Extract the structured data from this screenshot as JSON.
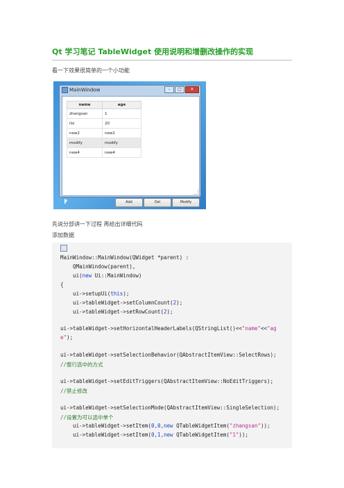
{
  "page": {
    "title": "Qt 学习笔记 TableWidget 使用说明和增删改操作的实现",
    "intro": "看一下效果很简单的一个小功能",
    "p2": "先说分部讲一下过程 再给出详细代码",
    "p3": "添加数据"
  },
  "window": {
    "title": "MainWindow",
    "controls": {
      "minimize": "–",
      "maximize": "□",
      "close": "✕"
    },
    "headers": [
      "name",
      "age"
    ],
    "rows": [
      [
        "zhangsan",
        "1"
      ],
      [
        "lisi",
        "20"
      ],
      [
        "new2",
        "new2"
      ],
      [
        "modify",
        "modify"
      ],
      [
        "new4",
        "new4"
      ]
    ],
    "buttons": {
      "add": "Add",
      "del": "Del",
      "modify": "Modify"
    }
  },
  "code": {
    "l1a": "MainWindow::MainWindow(QWidget *parent) :",
    "l2a": "    QMainWindow(parent),",
    "l3a": "    ui(",
    "l3kw": "new",
    "l3b": " Ui::MainWindow)",
    "l4a": "{",
    "l5a": "    ui->setupUi(",
    "l5kw": "this",
    "l5b": ");",
    "l6a": "    ui->tableWidget->setColumnCount(",
    "l6n": "2",
    "l6b": ");",
    "l7a": "    ui->tableWidget->setRowCount(",
    "l7n": "2",
    "l7b": ");",
    "l8a": "ui->tableWidget->setHorizontalHeaderLabels(QStringList()<<",
    "l8s1": "\"name\"",
    "l8b": "<<",
    "l8s2": "\"ag",
    "l9s": "e\"",
    "l9b": ");",
    "l10a": "ui->tableWidget->setSelectionBehavior(QAbstractItemView::SelectRows);",
    "l11c": "//整行选中的方式",
    "l12a": "ui->tableWidget->setEditTriggers(QAbstractItemView::NoEditTriggers);",
    "l13c": "//禁止修改",
    "l14a": "ui->tableWidget->setSelectionMode(QAbstractItemView::SingleSelection);",
    "l15c": "//设置为可以选中单个",
    "l16a": "    ui->tableWidget->setItem(",
    "l16n": "0,0,",
    "l16kw": "new",
    "l16b": " QTableWidgetItem(",
    "l16s": "\"zhangsan\"",
    "l16c": "));",
    "l17a": "    ui->tableWidget->setItem(",
    "l17n": "0,1,",
    "l17kw": "new",
    "l17b": " QTableWidgetItem(",
    "l17s": "\"1\"",
    "l17c": "));"
  }
}
